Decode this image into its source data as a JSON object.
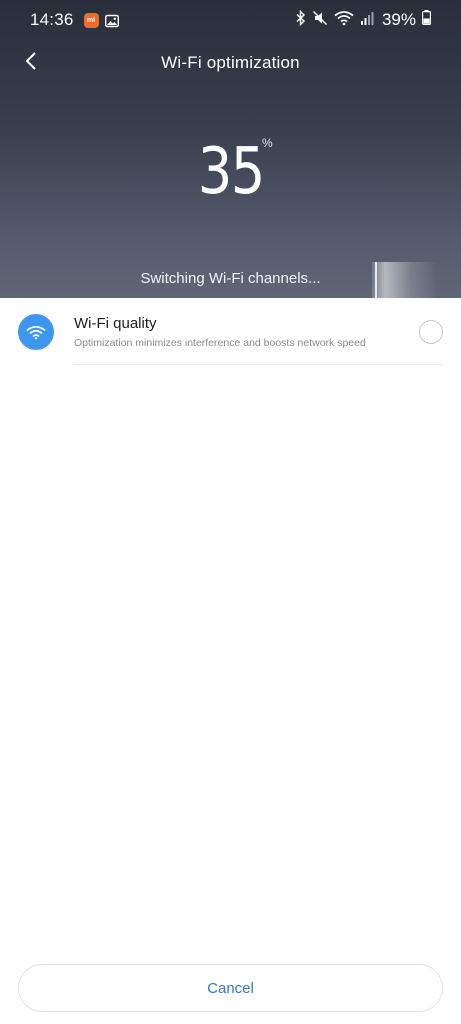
{
  "status_bar": {
    "time": "14:36",
    "battery": "39%",
    "icons": [
      "mi-app-icon",
      "gallery-icon",
      "bluetooth-icon",
      "mute-icon",
      "wifi-signal-icon",
      "cell-signal-icon",
      "battery-icon"
    ]
  },
  "header": {
    "title": "Wi-Fi optimization",
    "back_icon": "back-arrow-icon"
  },
  "progress": {
    "value": "35",
    "unit": "%",
    "status": "Switching Wi-Fi channels..."
  },
  "items": [
    {
      "title": "Wi-Fi quality",
      "subtitle": "Optimization minimizes interference and boosts network speed",
      "icon": "wifi-icon",
      "checked": false
    }
  ],
  "footer": {
    "cancel_label": "Cancel"
  },
  "colors": {
    "accent": "#3d97f0",
    "cancel_text": "#2f7bd0",
    "mi_badge": "#f26a2b"
  }
}
